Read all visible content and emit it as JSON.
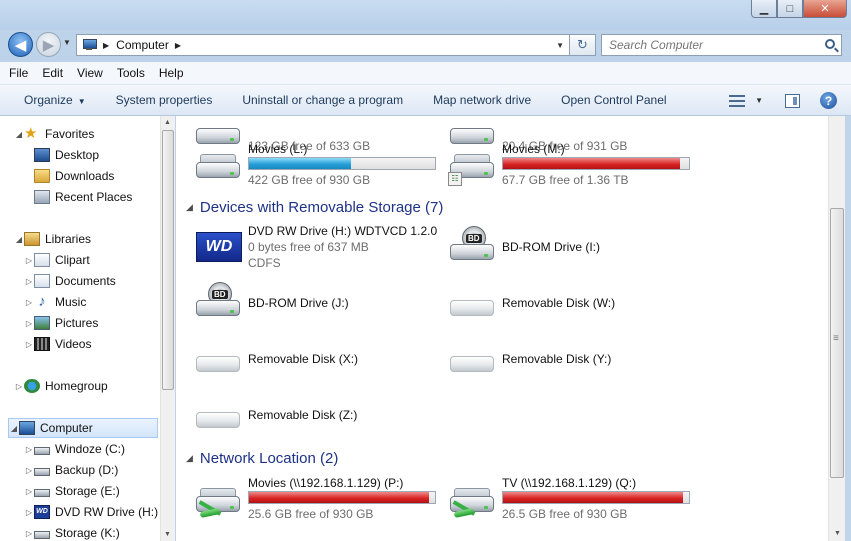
{
  "window": {
    "minimize_label": "▁",
    "maximize_label": "□",
    "close_label": "✕"
  },
  "address": {
    "back_glyph": "◀",
    "forward_glyph": "▶",
    "crumb_arrow": "▶",
    "crumb_current": "Computer",
    "crumb_arrow_after": "▶",
    "refresh_glyph": "↻",
    "search_placeholder": "Search Computer"
  },
  "menubar": {
    "items": [
      "File",
      "Edit",
      "View",
      "Tools",
      "Help"
    ]
  },
  "commandbar": {
    "organize": "Organize",
    "system_properties": "System properties",
    "uninstall": "Uninstall or change a program",
    "map_drive": "Map network drive",
    "control_panel": "Open Control Panel",
    "help_glyph": "?"
  },
  "navpane": {
    "items": [
      {
        "label": "Favorites",
        "icon": "star-icon"
      },
      {
        "label": "Desktop",
        "icon": "desktop-icon"
      },
      {
        "label": "Downloads",
        "icon": "downloads-folder-icon"
      },
      {
        "label": "Recent Places",
        "icon": "recent-places-icon"
      },
      {
        "label": "Libraries",
        "icon": "libraries-icon"
      },
      {
        "label": "Clipart",
        "icon": "clipart-library-icon"
      },
      {
        "label": "Documents",
        "icon": "documents-library-icon"
      },
      {
        "label": "Music",
        "icon": "music-library-icon"
      },
      {
        "label": "Pictures",
        "icon": "pictures-library-icon"
      },
      {
        "label": "Videos",
        "icon": "videos-library-icon"
      },
      {
        "label": "Homegroup",
        "icon": "homegroup-icon"
      },
      {
        "label": "Computer",
        "icon": "computer-icon"
      },
      {
        "label": "Windoze (C:)",
        "icon": "hard-drive-icon"
      },
      {
        "label": "Backup (D:)",
        "icon": "hard-drive-icon"
      },
      {
        "label": "Storage (E:)",
        "icon": "hard-drive-icon"
      },
      {
        "label": "DVD RW Drive (H:)",
        "icon": "wd-drive-icon"
      },
      {
        "label": "Storage (K:)",
        "icon": "hard-drive-icon"
      }
    ]
  },
  "content": {
    "top_drives": [
      {
        "free": "123 GB free of 633 GB"
      },
      {
        "free": "20.4 GB free of 931 GB"
      }
    ],
    "movies_l": {
      "name": "Movies (L:)",
      "free": "422 GB free of 930 GB",
      "used_fraction": 0.55,
      "bar_color": "#26a0da"
    },
    "movies_m": {
      "name": "Movies (M:)",
      "free": "67.7 GB free of 1.36 TB",
      "used_fraction": 0.95,
      "bar_color": "#da2626"
    },
    "removable_header": "Devices with Removable Storage (7)",
    "dvd_h": {
      "name": "DVD RW Drive (H:) WDTVCD 1.2.0",
      "free": "0 bytes free of 637 MB",
      "fs": "CDFS",
      "logo": "WD"
    },
    "bd_i": {
      "name": "BD-ROM Drive (I:)",
      "tag": "BD"
    },
    "bd_j": {
      "name": "BD-ROM Drive (J:)",
      "tag": "BD"
    },
    "rem_w": {
      "name": "Removable Disk (W:)"
    },
    "rem_x": {
      "name": "Removable Disk (X:)"
    },
    "rem_y": {
      "name": "Removable Disk (Y:)"
    },
    "rem_z": {
      "name": "Removable Disk (Z:)"
    },
    "network_header": "Network Location (2)",
    "net_p": {
      "name": "Movies (\\\\192.168.1.129) (P:)",
      "free": "25.6 GB free of 930 GB",
      "used_fraction": 0.97,
      "bar_color": "#da2626"
    },
    "net_q": {
      "name": "TV (\\\\192.168.1.129) (Q:)",
      "free": "26.5 GB free of 930 GB",
      "used_fraction": 0.97,
      "bar_color": "#da2626"
    }
  }
}
